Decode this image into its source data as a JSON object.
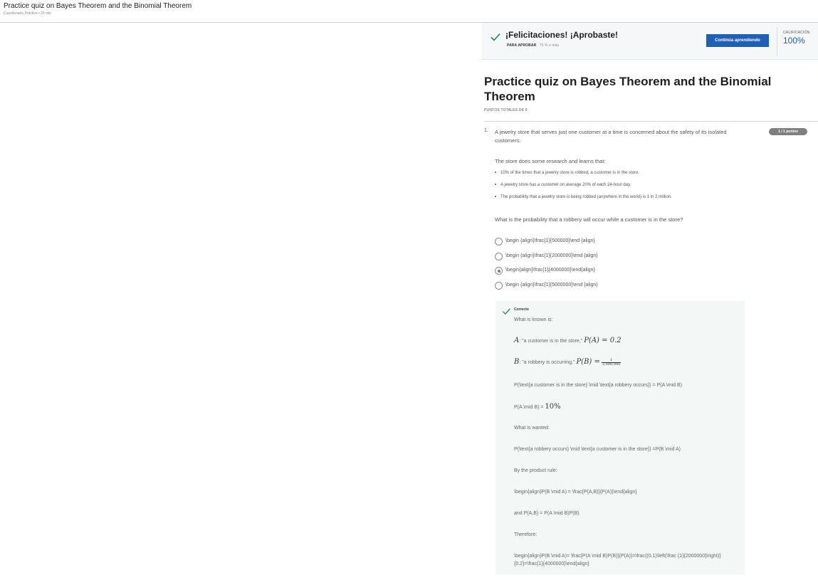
{
  "header": {
    "title": "Practice quiz on Bayes Theorem and the Binomial Theorem",
    "subtitle": "Cuestionario Práctico • 25 min"
  },
  "banner": {
    "heading": "¡Felicitaciones! ¡Aprobaste!",
    "pass_label": "PARA APROBAR",
    "pass_value": "75 % o más",
    "continue_button": "Continúa aprendiendo",
    "grade_label": "CALIFICACIÓN",
    "grade_value": "100%"
  },
  "quiz": {
    "title": "Practice quiz on Bayes Theorem and the Binomial Theorem",
    "total_points": "PUNTOS TOTALES DE 9"
  },
  "question": {
    "number": "1.",
    "text": "A jewelry store that serves just one customer at a time is concerned about the safety of its isolated customers.",
    "points_badge": "1 / 1 puntos",
    "intro": "The store does some research and learns that:",
    "bullets": [
      "10% of the times that a jewelry store is robbed, a customer is in the store.",
      "A jewelry store has a customer on average 20% of each 24-hour day.",
      "The probability that a jewelry store is being robbed (anywhere in the world) is 1 in 2 million."
    ],
    "ask": "What is the probability that a robbery will occur while a customer is in the store?",
    "options": [
      {
        "label": "\\begin {align}\\frac{1}{500000}\\end {align}",
        "selected": false
      },
      {
        "label": "\\begin {align}\\frac{1}{2000000}\\end {align}",
        "selected": false
      },
      {
        "label": "\\begin{align}\\frac{1}{4000000}\\end{align}",
        "selected": true
      },
      {
        "label": "\\begin {align}\\frac{1}{5000000}\\end {align}",
        "selected": false
      }
    ]
  },
  "feedback": {
    "status": "Correcto",
    "known": "What is known is:",
    "a_label": "A",
    "a_text": ": \"a customer is in the store,\"",
    "a_math": "P(A) = 0.2",
    "b_label": "B",
    "b_text": ": \"a robbery is occurring,\"",
    "b_math": "P(B) =",
    "b_num": "1",
    "b_den": "2,000,000",
    "cond_line": "P(\\text{a customer is in the store} \\mid \\text{a robbery occurs}) = P(A \\mid B)",
    "pab_prefix": "P(A \\mid B) =",
    "pab_value": "10%",
    "wanted": "What is wanted:",
    "wanted_line": "P(\\text{a robbery occurs} \\mid \\text{a customer is in the store}) =P(B \\mid A)",
    "product_rule": "By the product rule:",
    "product_formula": "\\begin{align}P(B \\mid A) = \\frac{P(A,B)}{P(A)}\\end{align}",
    "and_line": "and P(A,B) = P(A \\mid B)P(B)",
    "therefore": "Therefore:",
    "final_formula": "\\begin{align}P(B \\mid A)= \\frac{P(A \\mid B)P(B)}{P(A)}=\\frac{(0.1)\\left(\\frac {1}{2000000}\\right)}{0.2}=\\frac{1}{4000000}\\end{align}"
  }
}
